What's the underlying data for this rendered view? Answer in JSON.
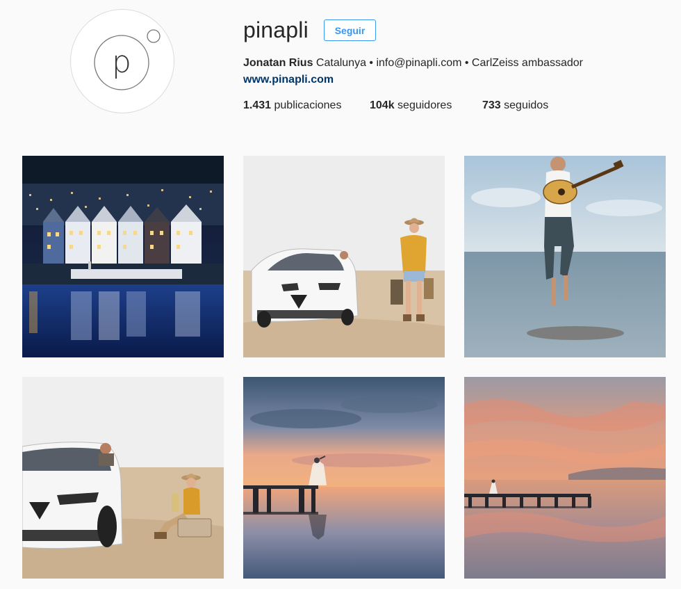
{
  "profile": {
    "username": "pinapli",
    "avatar_letter": "p",
    "follow_label": "Seguir",
    "full_name": "Jonatan Rius",
    "bio_text": " Catalunya • info@pinapli.com • CarlZeiss ambassador",
    "website": "www.pinapli.com"
  },
  "stats": {
    "posts_count": "1.431",
    "posts_label": " publicaciones",
    "followers_count": "104k",
    "followers_label": " seguidores",
    "following_count": "733",
    "following_label": " seguidos"
  },
  "colors": {
    "accent": "#3897f0",
    "link": "#003569",
    "background": "#fafafa"
  },
  "posts": [
    "harbor-town-night-photo",
    "white-car-woman-hat-beach-photo",
    "man-guitar-jumping-water-photo",
    "white-car-woman-sitting-photo",
    "woman-pier-sunset-photo",
    "pier-sunset-reflection-photo"
  ]
}
